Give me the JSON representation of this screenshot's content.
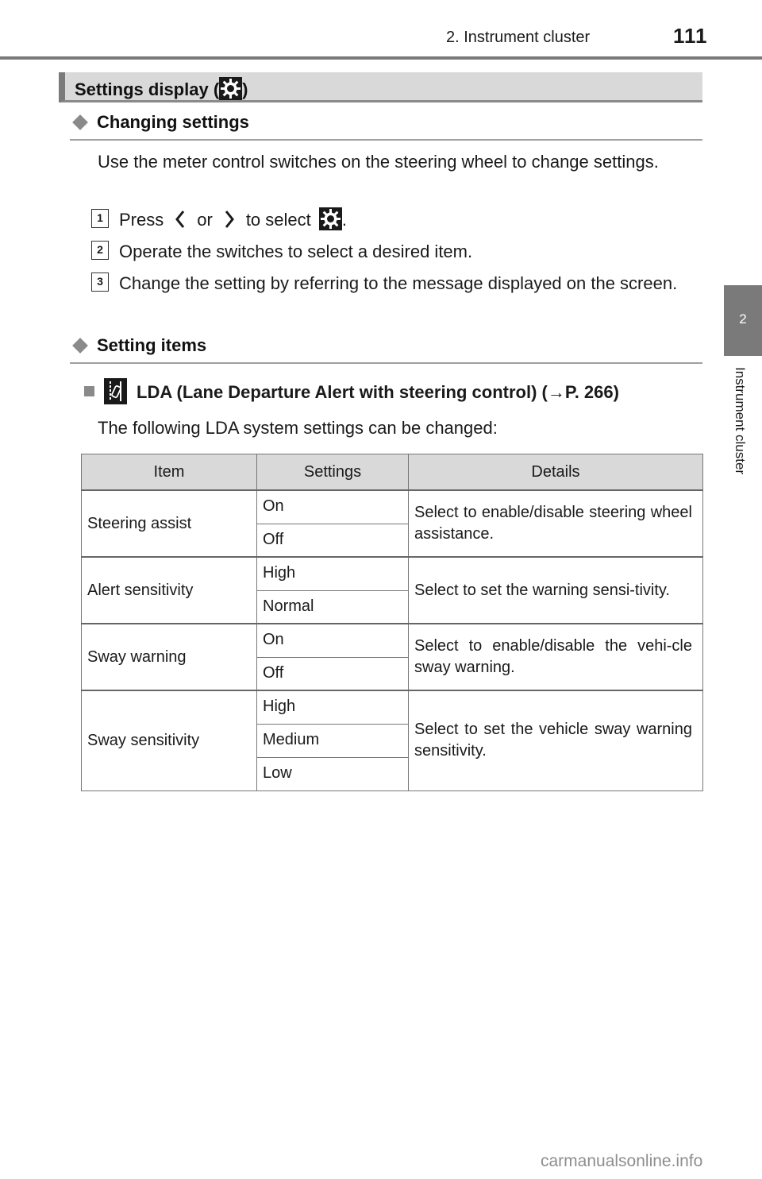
{
  "header": {
    "chapter_title": "2. Instrument cluster",
    "page_number": "111"
  },
  "side_tab": {
    "chapter_number": "2",
    "chapter_label": "Instrument cluster"
  },
  "section": {
    "title_prefix": "Settings display (",
    "title_suffix": ")",
    "title_icon": "gear-settings-icon"
  },
  "changing_settings": {
    "heading": "Changing settings",
    "intro": "Use the meter control switches on the steering wheel to change settings.",
    "steps": [
      {
        "number": "1",
        "text_before": "Press",
        "icon_left": "chevron-left-icon",
        "text_or": "or",
        "icon_right": "chevron-right-icon",
        "text_after": "to select",
        "end_icon": "gear-settings-icon",
        "end": "."
      },
      {
        "number": "2",
        "text": "Operate the switches to select a desired item."
      },
      {
        "number": "3",
        "text": "Change the setting by referring to the message displayed on the screen."
      }
    ]
  },
  "setting_items": {
    "heading": "Setting items",
    "lda_heading": "LDA (Lane Departure Alert with steering control) (",
    "lda_ref_arrow": "→",
    "lda_ref": "P. 266)",
    "lda_icon": "lane-departure-icon",
    "lda_intro": "The following LDA system settings can be changed:"
  },
  "table": {
    "headers": [
      "Item",
      "Settings",
      "Details"
    ],
    "rows": [
      {
        "item": "Steering assist",
        "settings": [
          "On",
          "Off"
        ],
        "details": "Select to enable/disable steering wheel assistance."
      },
      {
        "item": "Alert sensitivity",
        "settings": [
          "High",
          "Normal"
        ],
        "details": "Select to set the warning sensi-tivity."
      },
      {
        "item": "Sway warning",
        "settings": [
          "On",
          "Off"
        ],
        "details": "Select to enable/disable the vehi-cle sway warning."
      },
      {
        "item": "Sway sensitivity",
        "settings": [
          "High",
          "Medium",
          "Low"
        ],
        "details": "Select to set the vehicle sway warning sensitivity."
      }
    ]
  },
  "footer": {
    "watermark": "carmanualsonline.info"
  },
  "colors": {
    "bar_gray": "#d9d9d9",
    "accent_gray": "#7a7a7a",
    "icon_bg": "#1a1a1a"
  }
}
